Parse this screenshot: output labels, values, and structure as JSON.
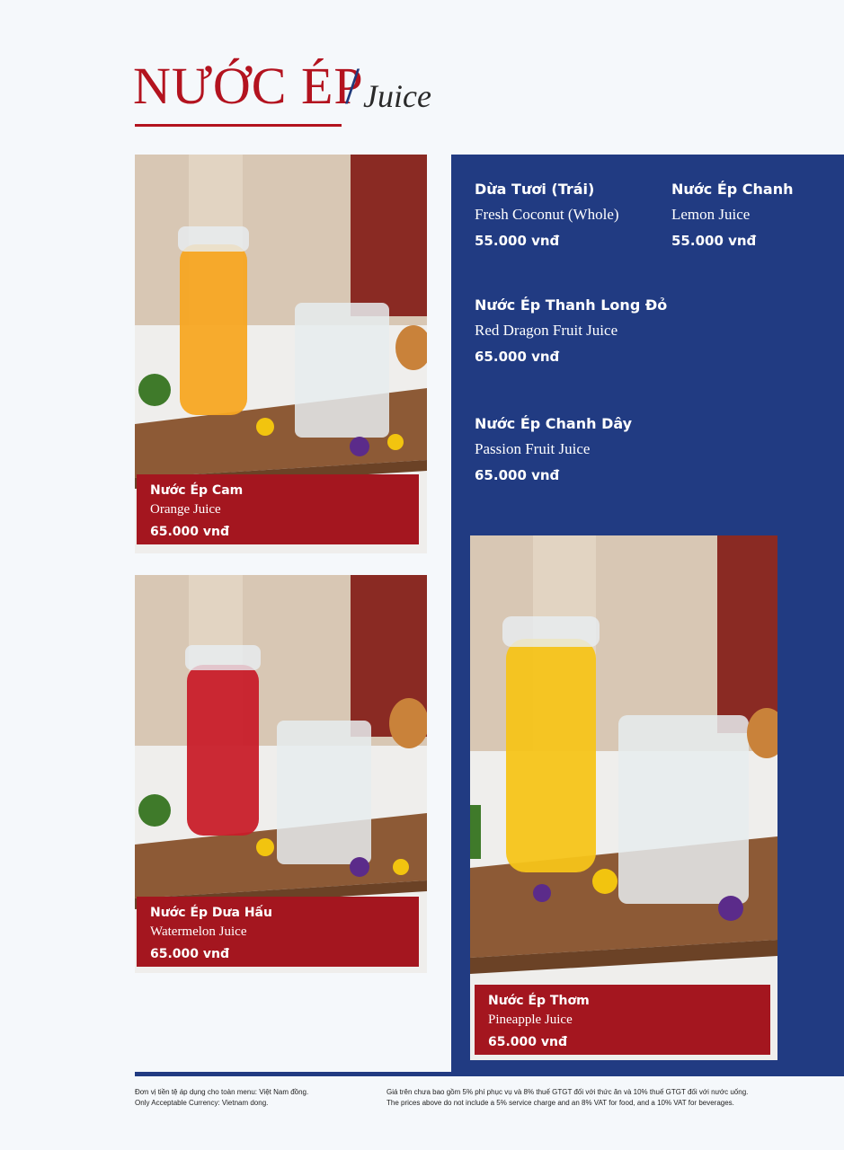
{
  "header": {
    "title_vn": "NƯỚC ÉP",
    "slash": "/",
    "title_en": "Juice"
  },
  "featured_items": [
    {
      "name_vn": "Nước Ép Cam",
      "name_en": "Orange Juice",
      "price": "65.000 vnđ",
      "juice_color": "#f7a623"
    },
    {
      "name_vn": "Nước Ép Dưa Hấu",
      "name_en": "Watermelon Juice",
      "price": "65.000 vnđ",
      "juice_color": "#c81e2a"
    },
    {
      "name_vn": "Nước Ép Thơm",
      "name_en": "Pineapple Juice",
      "price": "65.000 vnđ",
      "juice_color": "#f6c41a"
    }
  ],
  "menu_items": [
    {
      "name_vn": "Dừa Tươi (Trái)",
      "name_en": "Fresh Coconut (Whole)",
      "price": "55.000 vnđ"
    },
    {
      "name_vn": "Nước Ép Chanh",
      "name_en": "Lemon Juice",
      "price": "55.000 vnđ"
    },
    {
      "name_vn": "Nước Ép Thanh Long Đỏ",
      "name_en": "Red Dragon Fruit Juice",
      "price": "65.000 vnđ"
    },
    {
      "name_vn": "Nước Ép Chanh Dây",
      "name_en": "Passion Fruit Juice",
      "price": "65.000 vnđ"
    }
  ],
  "footer": {
    "currency_vn": "Đơn vị tiền tệ áp dụng cho toàn menu: Việt Nam đồng.",
    "currency_en": "Only Acceptable Currency: Vietnam dong.",
    "tax_vn": "Giá trên chưa bao gồm 5% phí phục vụ và 8% thuế GTGT đối với thức ăn và 10% thuế GTGT đối với nước uống.",
    "tax_en": "The prices above do not include a 5% service charge and an 8% VAT for food, and a 10% VAT for beverages."
  },
  "colors": {
    "brand_red": "#b3131f",
    "label_red": "#a4161f",
    "panel_blue": "#213b82",
    "page_bg": "#f5f8fb"
  }
}
